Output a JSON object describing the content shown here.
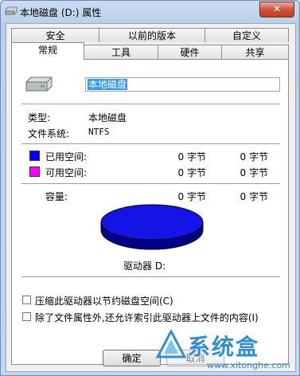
{
  "window": {
    "title": "本地磁盘 (D:) 属性",
    "close_glyph": "✕"
  },
  "tabs_row1": [
    "安全",
    "以前的版本",
    "自定义"
  ],
  "tabs_row2": [
    "常规",
    "工具",
    "硬件",
    "共享"
  ],
  "active_tab": "常规",
  "general": {
    "drive_name": "本地磁盘",
    "type_label": "类型:",
    "type_value": "本地磁盘",
    "fs_label": "文件系统:",
    "fs_value": "NTFS",
    "used_label": "已用空间:",
    "used_bytes": "0 字节",
    "used_size": "0 字节",
    "free_label": "可用空间:",
    "free_bytes": "0 字节",
    "free_size": "0 字节",
    "capacity_label": "容量:",
    "capacity_bytes": "0 字节",
    "capacity_size": "0 字节",
    "drive_label": "驱动器 D:",
    "compress_label": "压缩此驱动器以节约磁盘空间(C)",
    "index_label": "除了文件属性外,还允许索引此驱动器上文件的内容(I)"
  },
  "buttons": {
    "ok": "确定",
    "cancel": "取消"
  },
  "watermark": {
    "brand": "系统盒",
    "url": "www.xitonghe.com"
  },
  "colors": {
    "used": "#0000ff",
    "free": "#ff00ff",
    "pie": "#1414e6"
  }
}
